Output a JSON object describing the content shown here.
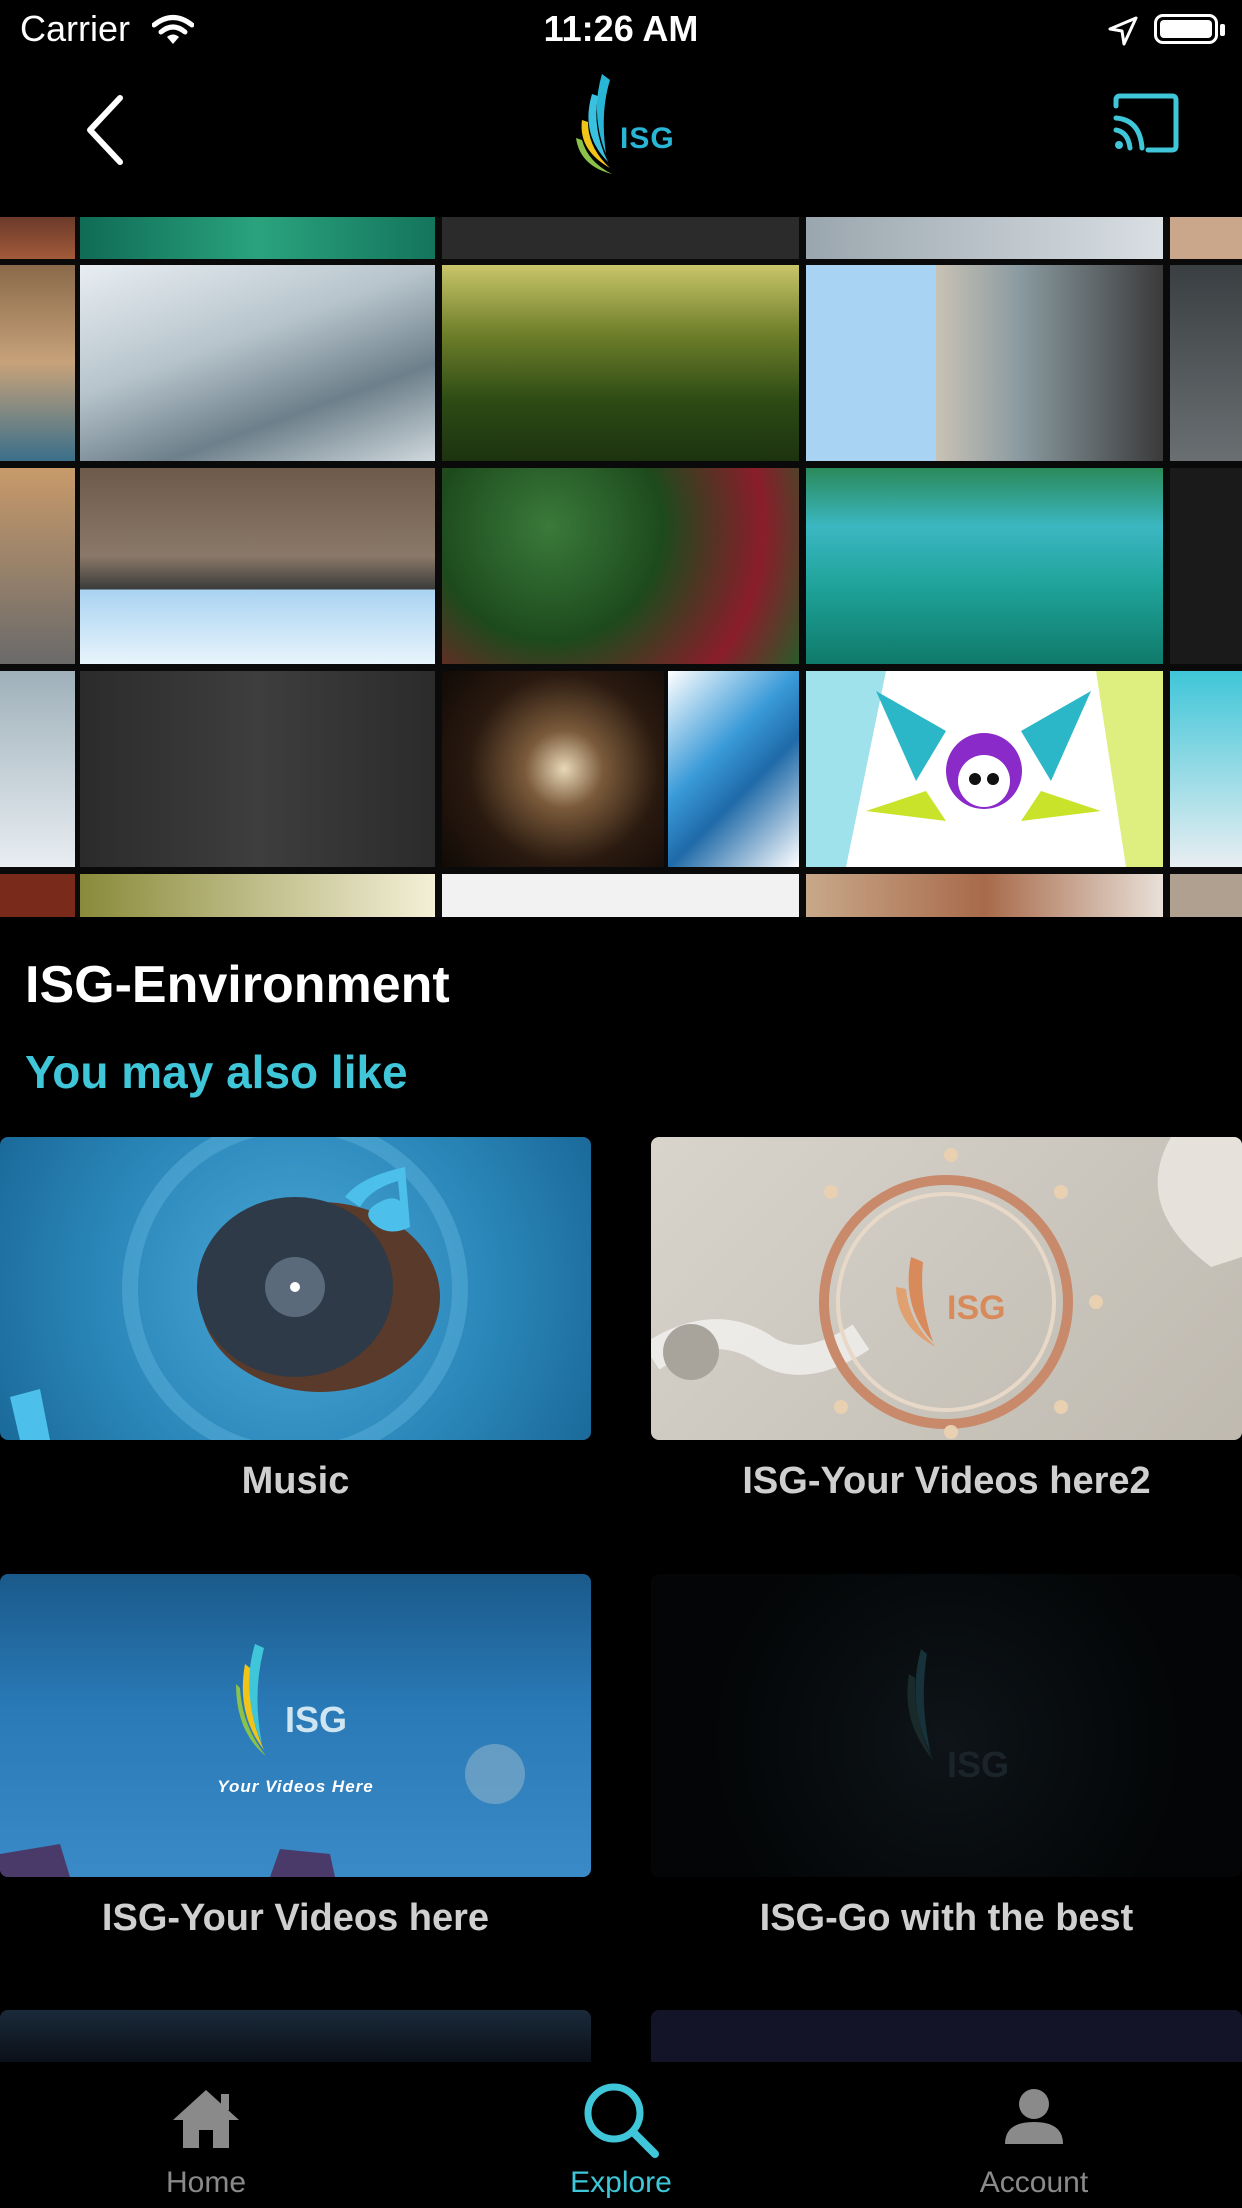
{
  "status_bar": {
    "carrier": "Carrier",
    "time": "11:26 AM"
  },
  "header": {
    "logo_text": "ISG"
  },
  "hero": {
    "tiles": [
      "mountain",
      "forest",
      "motorcycle",
      "city",
      "plants",
      "swimmer",
      "building",
      "skyscraper",
      "logo-swirl",
      "skull-emblem"
    ]
  },
  "main": {
    "title": "ISG-Environment",
    "subtitle": "You may also like",
    "cards": [
      {
        "label": "Music"
      },
      {
        "label": "ISG-Your Videos here2",
        "logo_text": "ISG"
      },
      {
        "label": "ISG-Your Videos here",
        "logo_text": "ISG",
        "tagline": "Your Videos Here"
      },
      {
        "label": "ISG-Go with the best",
        "logo_text": "ISG"
      }
    ]
  },
  "tabs": [
    {
      "label": "Home",
      "icon": "home-icon"
    },
    {
      "label": "Explore",
      "icon": "search-icon",
      "active": true
    },
    {
      "label": "Account",
      "icon": "account-icon"
    }
  ],
  "colors": {
    "accent": "#3fc6d8",
    "background": "#000000",
    "tab_inactive": "#8a8a8a"
  }
}
